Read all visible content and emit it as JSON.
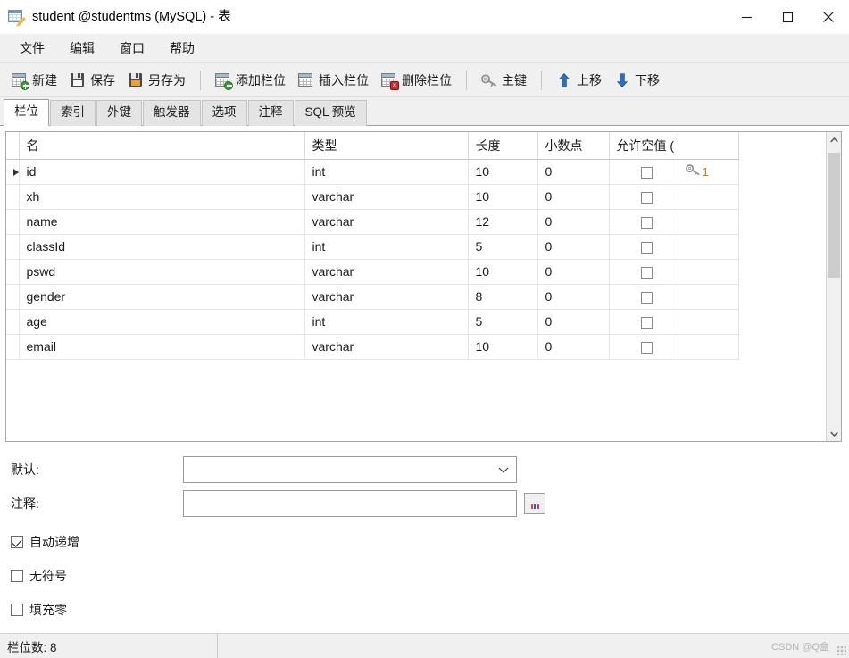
{
  "window": {
    "title": "student @studentms (MySQL) - 表",
    "icon": "table-edit-icon",
    "minimize_label": "—",
    "maximize_label": "□",
    "close_label": "✕"
  },
  "menubar": {
    "items": [
      {
        "label": "文件",
        "name": "menu-file"
      },
      {
        "label": "编辑",
        "name": "menu-edit"
      },
      {
        "label": "窗口",
        "name": "menu-window"
      },
      {
        "label": "帮助",
        "name": "menu-help"
      }
    ]
  },
  "toolbar": {
    "groups": [
      {
        "items": [
          {
            "label": "新建",
            "icon": "new-table-icon"
          },
          {
            "label": "保存",
            "icon": "save-icon"
          },
          {
            "label": "另存为",
            "icon": "save-as-icon"
          }
        ]
      },
      {
        "items": [
          {
            "label": "添加栏位",
            "icon": "add-field-icon"
          },
          {
            "label": "插入栏位",
            "icon": "insert-field-icon"
          },
          {
            "label": "删除栏位",
            "icon": "delete-field-icon"
          }
        ]
      },
      {
        "items": [
          {
            "label": "主键",
            "icon": "primary-key-icon"
          }
        ]
      },
      {
        "items": [
          {
            "label": "上移",
            "icon": "arrow-up-icon"
          },
          {
            "label": "下移",
            "icon": "arrow-down-icon"
          }
        ]
      }
    ]
  },
  "tabs": {
    "active_index": 0,
    "items": [
      {
        "label": "栏位",
        "name": "tab-fields"
      },
      {
        "label": "索引",
        "name": "tab-indexes"
      },
      {
        "label": "外键",
        "name": "tab-foreign-keys"
      },
      {
        "label": "触发器",
        "name": "tab-triggers"
      },
      {
        "label": "选项",
        "name": "tab-options"
      },
      {
        "label": "注释",
        "name": "tab-comment"
      },
      {
        "label": "SQL 预览",
        "name": "tab-sql-preview"
      }
    ]
  },
  "grid": {
    "headers": {
      "name": "名",
      "type": "类型",
      "length": "长度",
      "decimals": "小数点",
      "nullable": "允许空值 (",
      "key": ""
    },
    "selected_row_index": 0,
    "rows": [
      {
        "name": "id",
        "type": "int",
        "length": "10",
        "decimals": "0",
        "nullable": false,
        "key": "1"
      },
      {
        "name": "xh",
        "type": "varchar",
        "length": "10",
        "decimals": "0",
        "nullable": false,
        "key": ""
      },
      {
        "name": "name",
        "type": "varchar",
        "length": "12",
        "decimals": "0",
        "nullable": false,
        "key": ""
      },
      {
        "name": "classId",
        "type": "int",
        "length": "5",
        "decimals": "0",
        "nullable": false,
        "key": ""
      },
      {
        "name": "pswd",
        "type": "varchar",
        "length": "10",
        "decimals": "0",
        "nullable": false,
        "key": ""
      },
      {
        "name": "gender",
        "type": "varchar",
        "length": "8",
        "decimals": "0",
        "nullable": false,
        "key": ""
      },
      {
        "name": "age",
        "type": "int",
        "length": "5",
        "decimals": "0",
        "nullable": false,
        "key": ""
      },
      {
        "name": "email",
        "type": "varchar",
        "length": "10",
        "decimals": "0",
        "nullable": false,
        "key": ""
      }
    ]
  },
  "properties": {
    "default_label": "默认:",
    "default_value": "",
    "comment_label": "注释:",
    "comment_value": "",
    "ellipsis_label": "",
    "checkboxes": [
      {
        "label": "自动递增",
        "checked": true,
        "name": "checkbox-auto-increment"
      },
      {
        "label": "无符号",
        "checked": false,
        "name": "checkbox-unsigned"
      },
      {
        "label": "填充零",
        "checked": false,
        "name": "checkbox-zerofill"
      }
    ]
  },
  "statusbar": {
    "field_count": "栏位数: 8",
    "watermark": "CSDN @Q盒"
  },
  "colors": {
    "chrome": "#f0f0f0",
    "grid_line": "#e4e4e4",
    "key_number": "#c07a10",
    "accent_blue": "#6d9bc3"
  }
}
